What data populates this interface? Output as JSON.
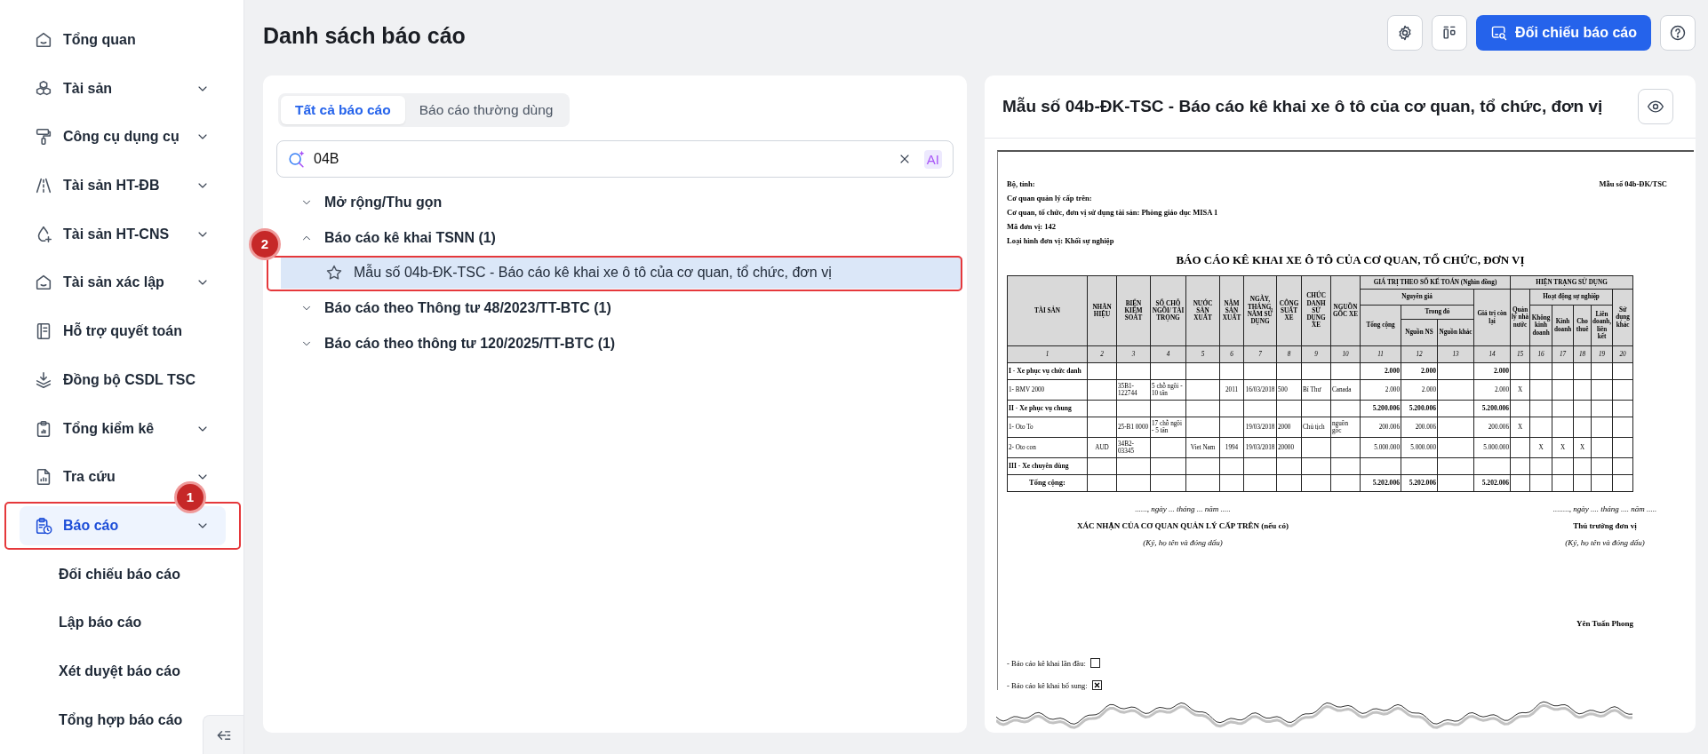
{
  "sidebar": {
    "items": [
      {
        "label": "Tổng quan",
        "expandable": false,
        "selected": false
      },
      {
        "label": "Tài sản",
        "expandable": true,
        "selected": false
      },
      {
        "label": "Công cụ dụng cụ",
        "expandable": true,
        "selected": false
      },
      {
        "label": "Tài sản HT-ĐB",
        "expandable": true,
        "selected": false
      },
      {
        "label": "Tài sản HT-CNS",
        "expandable": true,
        "selected": false
      },
      {
        "label": "Tài sản xác lập",
        "expandable": true,
        "selected": false
      },
      {
        "label": "Hỗ trợ quyết toán",
        "expandable": false,
        "selected": false
      },
      {
        "label": "Đồng bộ CSDL TSC",
        "expandable": false,
        "selected": false
      },
      {
        "label": "Tổng kiểm kê",
        "expandable": true,
        "selected": false
      },
      {
        "label": "Tra cứu",
        "expandable": true,
        "selected": false
      },
      {
        "label": "Báo cáo",
        "expandable": true,
        "selected": true,
        "callout": "1",
        "children": [
          {
            "label": "Đối chiếu báo cáo",
            "selected": false
          },
          {
            "label": "Lập báo cáo",
            "selected": false
          },
          {
            "label": "Xét duyệt báo cáo",
            "selected": false
          },
          {
            "label": "Tổng hợp báo cáo",
            "selected": false
          }
        ]
      }
    ]
  },
  "page": {
    "title": "Danh sách báo cáo"
  },
  "toolbar": [
    {
      "kind": "settings"
    },
    {
      "kind": "layout"
    },
    {
      "kind": "primary",
      "label": "Đối chiếu báo cáo"
    },
    {
      "kind": "help"
    }
  ],
  "report_list": {
    "tabs": [
      {
        "label": "Tất cả báo cáo",
        "selected": true
      },
      {
        "label": "Báo cáo thường dùng",
        "selected": false
      }
    ],
    "search": {
      "value": "04B",
      "badge": "AI"
    },
    "tree": [
      {
        "label": "Mở rộng/Thu gọn",
        "expanded": false
      },
      {
        "label": "Báo cáo kê khai TSNN (1)",
        "expanded": true,
        "children": [
          {
            "label": "Mẫu số 04b-ĐK-TSC - Báo cáo kê khai xe ô tô của cơ quan, tổ chức, đơn vị",
            "starred": false,
            "selected": true,
            "callout": "2"
          }
        ]
      },
      {
        "label": "Báo cáo theo Thông tư 48/2023/TT-BTC (1)",
        "expanded": false
      },
      {
        "label": "Báo cáo theo thông tư 120/2025/TT-BTC (1)",
        "expanded": false
      }
    ]
  },
  "preview": {
    "title": "Mẫu số 04b-ĐK-TSC - Báo cáo kê khai xe ô tô của cơ quan, tổ chức, đơn vị",
    "document": {
      "header_lines": [
        "Bộ, tỉnh:",
        "Cơ quan quản lý cấp trên:",
        "Cơ quan, tổ chức, đơn vị sử dụng tài sản: Phòng giáo dục MISA 1",
        "Mã đơn vị: 142",
        "Loại hình đơn vị: Khối sự nghiệp"
      ],
      "form_code": "Mẫu số 04b-ĐK/TSC",
      "title": "BÁO CÁO KÊ KHAI XE Ô TÔ CỦA CƠ QUAN, TỔ CHỨC, ĐƠN VỊ",
      "table": {
        "header_rows": [
          [
            {
              "text": "TÀI SẢN",
              "rowspan": 4
            },
            {
              "text": "NHÃN HIỆU",
              "rowspan": 4
            },
            {
              "text": "BIỂN KIỂM SOÁT",
              "rowspan": 4
            },
            {
              "text": "SỐ CHỖ NGỒI/ TẢI TRỌNG",
              "rowspan": 4
            },
            {
              "text": "NƯỚC SẢN XUẤT",
              "rowspan": 4
            },
            {
              "text": "NĂM SẢN XUẤT",
              "rowspan": 4
            },
            {
              "text": "NGÀY, THÁNG, NĂM SỬ DỤNG",
              "rowspan": 4
            },
            {
              "text": "CÔNG SUẤT XE",
              "rowspan": 4
            },
            {
              "text": "CHỨC DANH SỬ DỤNG XE",
              "rowspan": 4
            },
            {
              "text": "NGUỒN GỐC XE",
              "rowspan": 4
            },
            {
              "text": "GIÁ TRỊ THEO SỐ KẾ TOÁN (Nghìn đồng)",
              "colspan": 4
            },
            {
              "text": "HIỆN TRẠNG SỬ DỤNG",
              "colspan": 6
            }
          ],
          [
            {
              "text": "Nguyên giá",
              "colspan": 3
            },
            {
              "text": "Giá trị còn lại",
              "rowspan": 3
            },
            {
              "text": "Quản lý nhà nước",
              "rowspan": 3
            },
            {
              "text": "Hoạt động sự nghiệp",
              "colspan": 4
            },
            {
              "text": "Sử dụng khác",
              "rowspan": 3
            }
          ],
          [
            {
              "text": "Tổng cộng",
              "rowspan": 2
            },
            {
              "text": "Trong đó",
              "colspan": 2
            },
            {
              "text": "Không kinh doanh",
              "rowspan": 2
            },
            {
              "text": "Kinh doanh",
              "rowspan": 2
            },
            {
              "text": "Cho thuê",
              "rowspan": 2
            },
            {
              "text": "Liên doanh, liên kết",
              "rowspan": 2
            }
          ],
          [
            {
              "text": "Nguồn NS"
            },
            {
              "text": "Nguồn khác"
            }
          ]
        ],
        "column_numbers": [
          "1",
          "2",
          "3",
          "4",
          "5",
          "6",
          "7",
          "8",
          "9",
          "10",
          "11",
          "12",
          "13",
          "14",
          "15",
          "16",
          "17",
          "18",
          "19",
          "20"
        ],
        "rows": [
          {
            "kind": "group",
            "cells": [
              "I - Xe phục vụ chức danh",
              null,
              null,
              null,
              null,
              null,
              null,
              null,
              null,
              null,
              "2.000",
              "2.000",
              null,
              "2.000",
              null,
              null,
              null,
              null,
              null,
              null
            ]
          },
          {
            "kind": "item",
            "cells": [
              "1- BMV 2000",
              null,
              "35B1-122744",
              "5 chỗ ngồi - 10 tấn",
              null,
              "2011",
              "16/03/2018",
              "500",
              "Bí Thư",
              "Canada",
              "2.000",
              "2.000",
              null,
              "2.000",
              "X",
              null,
              null,
              null,
              null,
              null
            ]
          },
          {
            "kind": "group",
            "cells": [
              "II - Xe phục vụ chung",
              null,
              null,
              null,
              null,
              null,
              null,
              null,
              null,
              null,
              "5.200.006",
              "5.200.006",
              null,
              "5.200.006",
              null,
              null,
              null,
              null,
              null,
              null
            ]
          },
          {
            "kind": "item",
            "cells": [
              "1- Oto To",
              null,
              "25-B1 0000",
              "17 chỗ ngồi - 5 tấn",
              null,
              null,
              "19/03/2018",
              "2000",
              "Chủ tịch",
              "nguồn gốc",
              "200.006",
              "200.006",
              null,
              "200.006",
              "X",
              null,
              null,
              null,
              null,
              null
            ]
          },
          {
            "kind": "item",
            "cells": [
              "2- Oto con",
              "AUD",
              "34B2-03345",
              null,
              "Viet Nam",
              "1994",
              "19/03/2018",
              "20000",
              null,
              null,
              "5.000.000",
              "5.000.000",
              null,
              "5.000.000",
              null,
              "X",
              "X",
              "X",
              null,
              null
            ]
          },
          {
            "kind": "group",
            "cells": [
              "III - Xe chuyên dùng",
              null,
              null,
              null,
              null,
              null,
              null,
              null,
              null,
              null,
              null,
              null,
              null,
              null,
              null,
              null,
              null,
              null,
              null,
              null
            ]
          },
          {
            "kind": "total",
            "cells": [
              "Tổng cộng:",
              null,
              null,
              null,
              null,
              null,
              null,
              null,
              null,
              null,
              "5.202.006",
              "5.202.006",
              null,
              "5.202.006",
              null,
              null,
              null,
              null,
              null,
              null
            ]
          }
        ]
      },
      "signatures": [
        {
          "date_line": "......, ngày ... tháng ... năm .....",
          "role": "XÁC NHẬN CỦA CƠ QUAN QUẢN LÝ CẤP TRÊN (nếu có)",
          "note": "(Ký, họ tên và đóng dấu)"
        },
        {
          "date_line": "........, ngày .... tháng .... năm .....",
          "role": "Thủ trưởng đơn vị",
          "note": "(Ký, họ tên và đóng dấu)",
          "signer": "Yên Tuấn Phong"
        }
      ],
      "declarations": [
        {
          "label": "- Báo cáo kê khai lần đầu:",
          "checked": false
        },
        {
          "label": "- Báo cáo kê khai bổ sung:",
          "checked": true
        }
      ]
    }
  }
}
